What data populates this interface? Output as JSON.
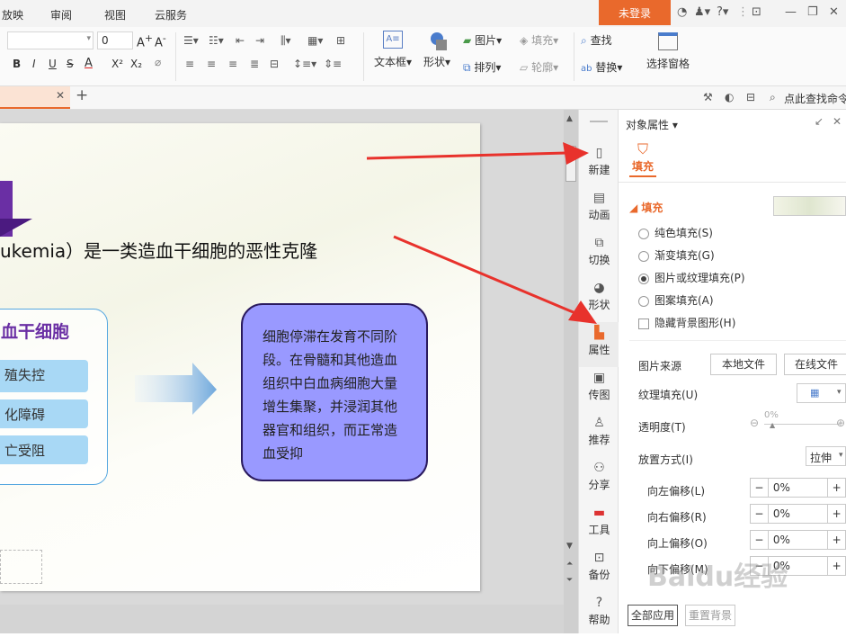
{
  "menu": {
    "items": [
      "放映",
      "审阅",
      "视图",
      "云服务"
    ],
    "login": "未登录"
  },
  "ribbon": {
    "font_size_value": "0",
    "textbox": "文本框",
    "shape": "形状",
    "picture": "图片",
    "fill": "填充",
    "arrange": "排列",
    "outline": "轮廓",
    "find": "查找",
    "replace": "替换",
    "select_pane": "选择窗格"
  },
  "tabbar": {
    "search_placeholder": "点此查找命令"
  },
  "slide": {
    "title": "ukemia）是一类造血干细胞的恶性克隆",
    "left_box_title": "血干细胞",
    "left_items": [
      "殖失控",
      "化障碍",
      "亡受阻"
    ],
    "right_box_text": "细胞停滞在发育不同阶段。在骨髓和其他造血组织中白血病细胞大量增生集聚，并浸润其他器官和组织，而正常造血受抑"
  },
  "sidebar": {
    "items": [
      "新建",
      "动画",
      "切换",
      "形状",
      "属性",
      "传图",
      "推荐",
      "分享",
      "工具",
      "备份",
      "帮助"
    ]
  },
  "panel": {
    "title": "对象属性",
    "tab": "填充",
    "section": "填充",
    "options": [
      "纯色填充(S)",
      "渐变填充(G)",
      "图片或纹理填充(P)",
      "图案填充(A)"
    ],
    "hide_bg": "隐藏背景图形(H)",
    "pic_source": "图片来源",
    "local_file": "本地文件",
    "online_file": "在线文件",
    "texture_fill": "纹理填充(U)",
    "transparency": "透明度(T)",
    "transparency_value": "0%",
    "placement": "放置方式(I)",
    "placement_value": "拉伸",
    "offsets": [
      {
        "label": "向左偏移(L)",
        "value": "0%"
      },
      {
        "label": "向右偏移(R)",
        "value": "0%"
      },
      {
        "label": "向上偏移(O)",
        "value": "0%"
      },
      {
        "label": "向下偏移(M)",
        "value": "0%"
      }
    ],
    "apply_all": "全部应用",
    "reset_bg": "重置背景"
  },
  "watermark": "Baidu经验",
  "colors": {
    "accent": "#e9692c",
    "arrow": "#e8322c",
    "box_fill": "#9999ff"
  }
}
